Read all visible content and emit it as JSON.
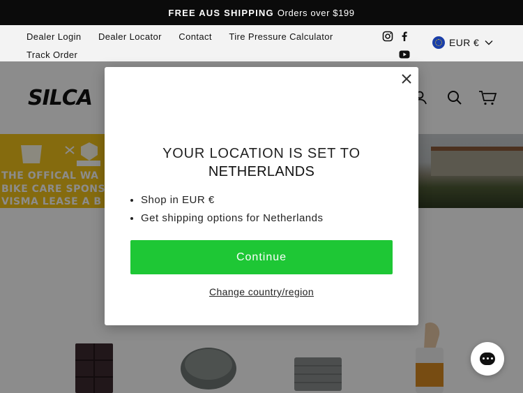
{
  "announcement": {
    "bold": "FREE AUS SHIPPING",
    "text": "Orders over $199"
  },
  "utility_nav": {
    "links": [
      "Dealer Login",
      "Dealer Locator",
      "Contact",
      "Tire Pressure Calculator",
      "Track Order"
    ],
    "social": [
      "instagram-icon",
      "facebook-icon",
      "youtube-icon"
    ],
    "currency": "EUR €"
  },
  "header": {
    "logo": "SILCA",
    "icons": [
      "account-icon",
      "search-icon",
      "cart-icon"
    ]
  },
  "banner": {
    "lines": [
      "THE OFFICAL WA",
      "BIKE CARE SPONSO",
      "VISMA LEASE A B"
    ]
  },
  "modal": {
    "heading": "YOUR LOCATION IS SET TO",
    "country": "NETHERLANDS",
    "bullets": [
      "Shop in EUR €",
      "Get shipping options for Netherlands"
    ],
    "continue_label": "Continue",
    "change_label": "Change country/region"
  },
  "colors": {
    "continue": "#1ec735",
    "banner_yellow": "#f2c31b",
    "announce_bg": "#0b0b0b"
  }
}
